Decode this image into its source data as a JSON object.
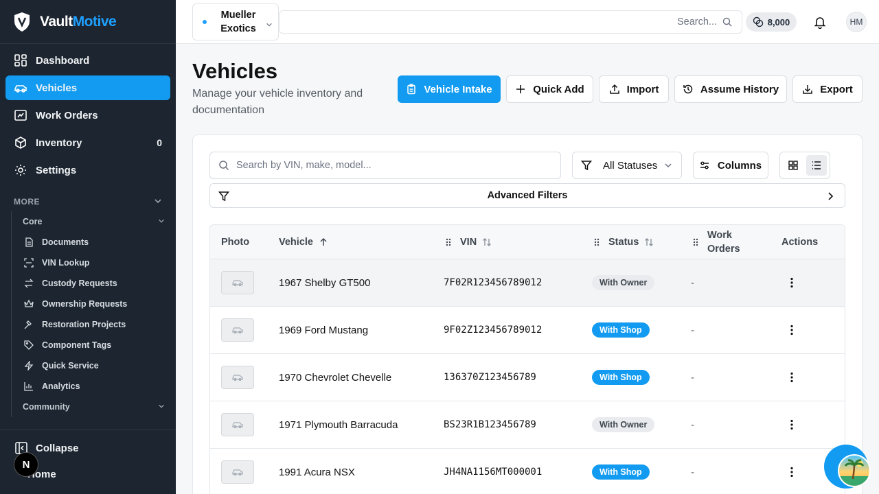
{
  "brand": {
    "name_a": "Vault",
    "name_b": "Motive",
    "accent": "#1ea0ff"
  },
  "sidebar": {
    "items": [
      {
        "label": "Dashboard",
        "icon": "grid-icon"
      },
      {
        "label": "Vehicles",
        "icon": "car-icon",
        "active": true
      },
      {
        "label": "Work Orders",
        "icon": "work-orders-icon"
      },
      {
        "label": "Inventory",
        "icon": "box-icon",
        "count": "0"
      },
      {
        "label": "Settings",
        "icon": "gear-icon"
      }
    ],
    "more_label": "MORE",
    "core_label": "Core",
    "core_items": [
      {
        "label": "Documents",
        "icon": "document-icon"
      },
      {
        "label": "VIN Lookup",
        "icon": "scan-icon"
      },
      {
        "label": "Custody Requests",
        "icon": "swap-icon"
      },
      {
        "label": "Ownership Requests",
        "icon": "crown-icon"
      },
      {
        "label": "Restoration Projects",
        "icon": "hammer-icon"
      },
      {
        "label": "Component Tags",
        "icon": "tag-icon"
      },
      {
        "label": "Quick Service",
        "icon": "bolt-icon"
      },
      {
        "label": "Analytics",
        "icon": "chart-icon"
      }
    ],
    "community_label": "Community",
    "collapse_label": "Collapse",
    "home_label": "Home",
    "n_badge": "N"
  },
  "topbar": {
    "org_line1": "Mueller",
    "org_line2": "Exotics",
    "search_placeholder": "Search...",
    "credits": "8,000",
    "avatar_initials": "HM"
  },
  "page": {
    "title": "Vehicles",
    "subtitle": "Manage your vehicle inventory and documentation",
    "buttons": {
      "intake": "Vehicle Intake",
      "quick_add": "Quick Add",
      "import": "Import",
      "assume_history": "Assume History",
      "export": "Export"
    }
  },
  "filters": {
    "search_placeholder": "Search by VIN, make, model...",
    "status": "All Statuses",
    "columns": "Columns",
    "advanced": "Advanced Filters"
  },
  "table": {
    "headers": {
      "photo": "Photo",
      "vehicle": "Vehicle",
      "vin": "VIN",
      "status": "Status",
      "work_orders_1": "Work",
      "work_orders_2": "Orders",
      "actions": "Actions"
    },
    "rows": [
      {
        "vehicle": "1967 Shelby GT500",
        "vin": "7F02R123456789012",
        "status": "With Owner",
        "kind": "owner",
        "work_orders": "-"
      },
      {
        "vehicle": "1969 Ford Mustang",
        "vin": "9F02Z123456789012",
        "status": "With Shop",
        "kind": "shop",
        "work_orders": "-"
      },
      {
        "vehicle": "1970 Chevrolet Chevelle",
        "vin": "136370Z123456789",
        "status": "With Shop",
        "kind": "shop",
        "work_orders": "-"
      },
      {
        "vehicle": "1971 Plymouth Barracuda",
        "vin": "BS23R1B123456789",
        "status": "With Owner",
        "kind": "owner",
        "work_orders": "-"
      },
      {
        "vehicle": "1991 Acura NSX",
        "vin": "JH4NA1156MT000001",
        "status": "With Shop",
        "kind": "shop",
        "work_orders": "-"
      }
    ]
  },
  "colors": {
    "primary": "#129bf0",
    "sidebar_bg": "#1c2530"
  }
}
